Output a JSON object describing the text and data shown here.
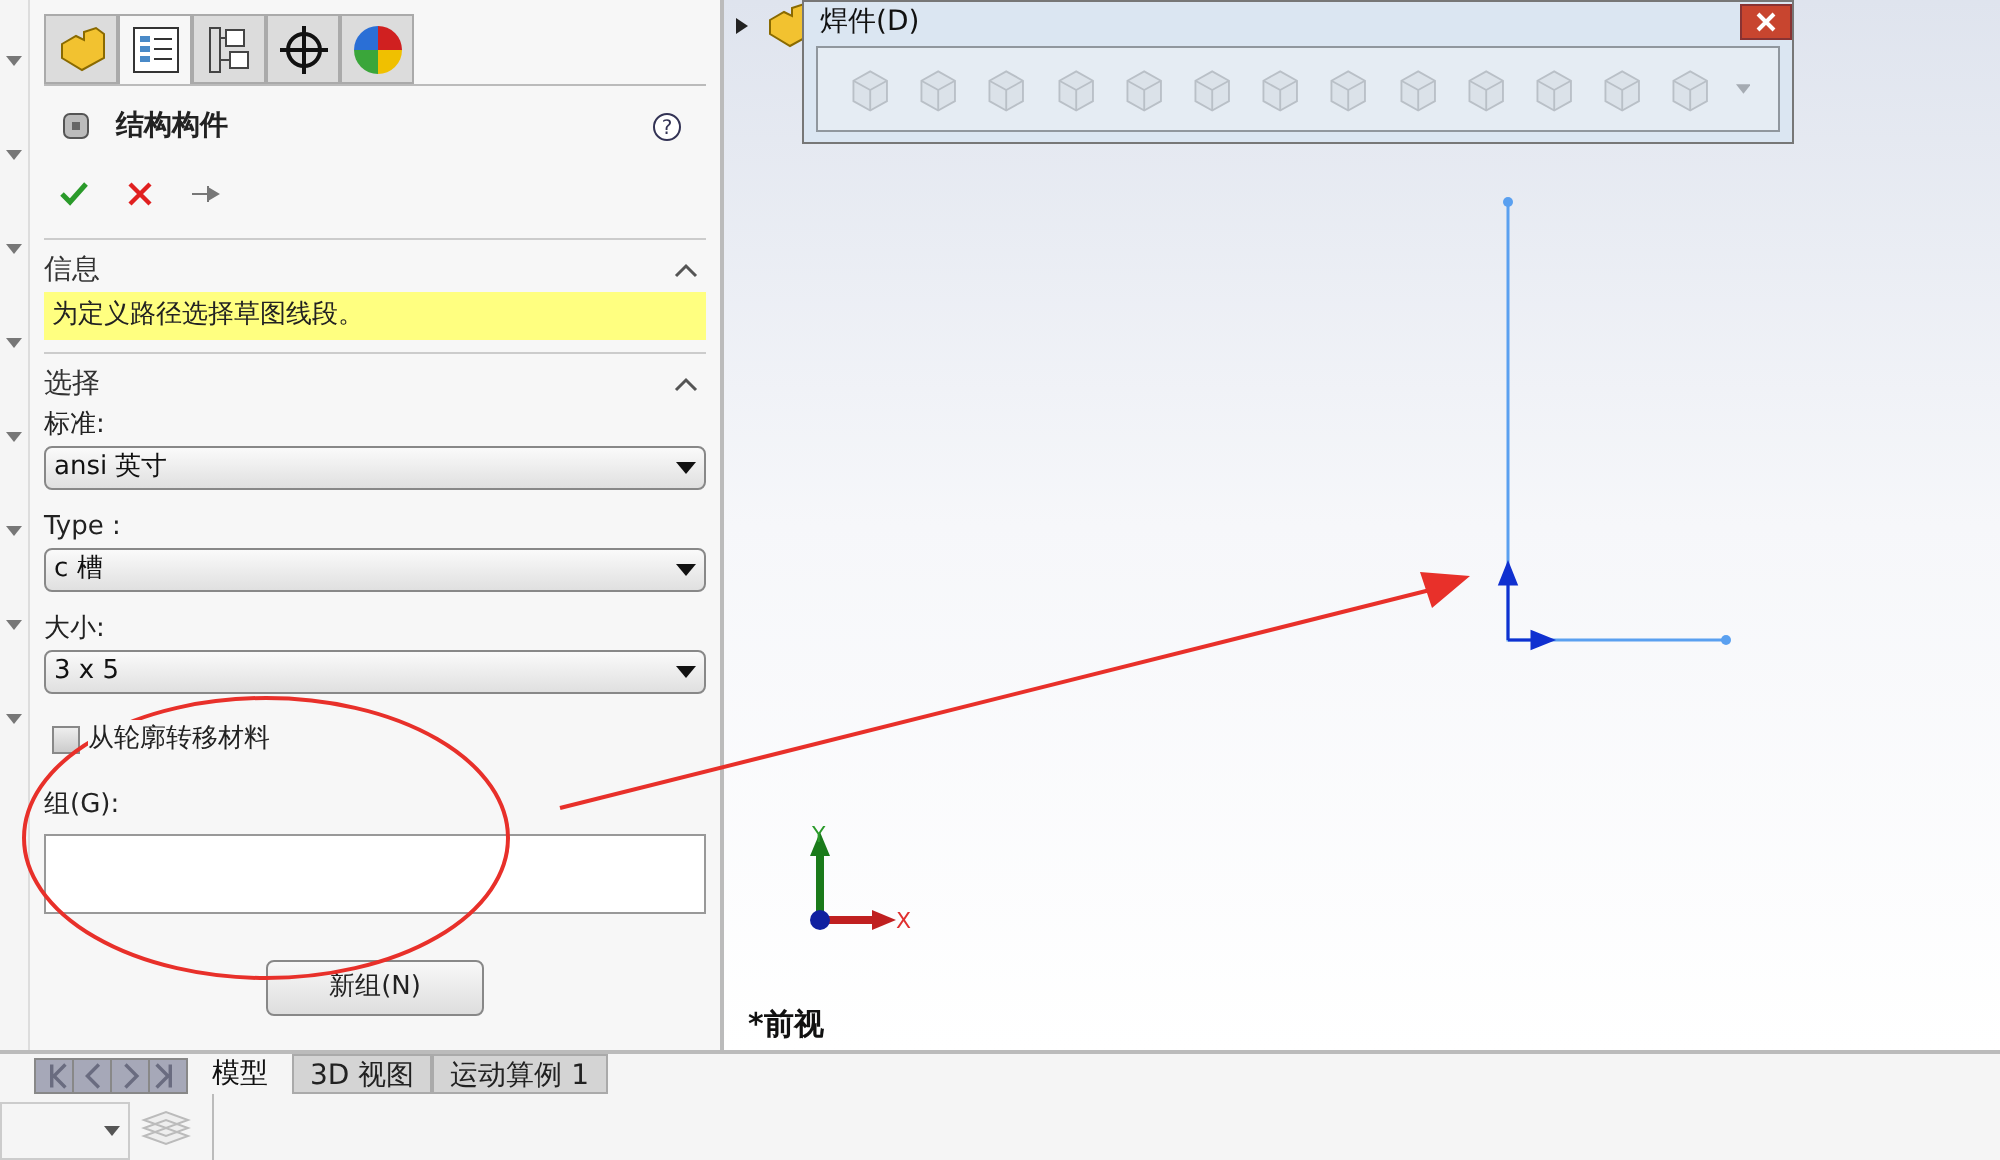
{
  "panel_tabs": [
    {
      "kind": "part",
      "selected": false
    },
    {
      "kind": "property",
      "selected": true
    },
    {
      "kind": "config",
      "selected": false
    },
    {
      "kind": "target",
      "selected": false
    },
    {
      "kind": "appearance",
      "selected": false
    }
  ],
  "feature": {
    "title": "结构构件",
    "help": "?"
  },
  "info": {
    "title": "信息",
    "expanded": true,
    "message": "为定义路径选择草图线段。"
  },
  "selection": {
    "title": "选择",
    "expanded": true,
    "fields": [
      {
        "label": "标准:",
        "value": "ansi 英寸"
      },
      {
        "label": "Type :",
        "value": "c 槽"
      },
      {
        "label": "大小:",
        "value": "3 x 5"
      }
    ],
    "transfer_material": {
      "label": "从轮廓转移材料",
      "checked": false
    },
    "group": {
      "label": "组(G):"
    },
    "new_group_button": "新组(N)"
  },
  "toolbar": {
    "title": "焊件(D)",
    "disabled": true
  },
  "view": {
    "name": "*前视",
    "x_label": "X",
    "y_label": "Y"
  },
  "bottom_tabs": [
    {
      "label": "模型",
      "selected": true
    },
    {
      "label": "3D 视图",
      "selected": false
    },
    {
      "label": "运动算例 1",
      "selected": false
    }
  ]
}
